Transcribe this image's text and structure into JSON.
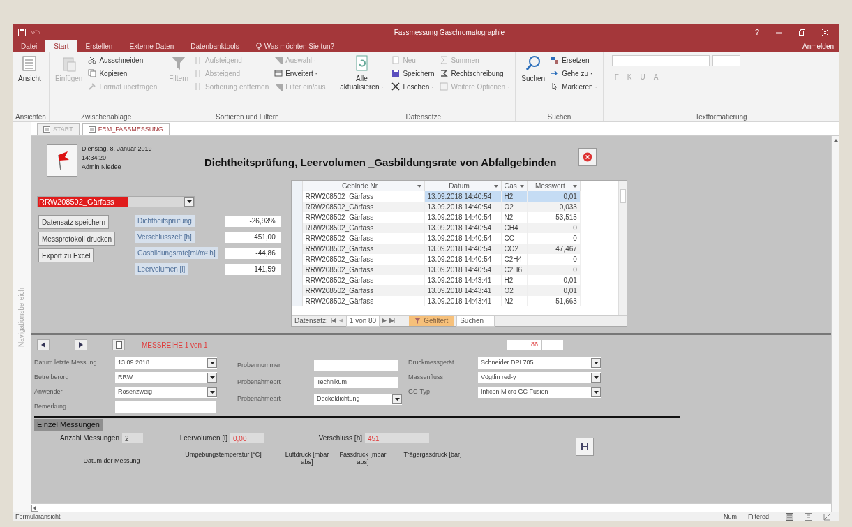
{
  "window": {
    "title": "Fassmessung Gaschromatographie",
    "account": "Anmelden",
    "help": "?"
  },
  "ribbon_tabs": [
    {
      "label": "Datei",
      "selected": false
    },
    {
      "label": "Start",
      "selected": true
    },
    {
      "label": "Erstellen",
      "selected": false
    },
    {
      "label": "Externe Daten",
      "selected": false
    },
    {
      "label": "Datenbanktools",
      "selected": false
    }
  ],
  "tell_me": "Was möchten Sie tun?",
  "ribbon_groups": [
    {
      "label": "Ansichten",
      "items": [
        {
          "label": "Ansicht",
          "kind": "large",
          "disabled": false
        }
      ]
    },
    {
      "label": "Zwischenablage",
      "items": [
        {
          "label": "Einfügen",
          "kind": "large",
          "disabled": true
        },
        {
          "label": "Ausschneiden",
          "kind": "small",
          "disabled": false
        },
        {
          "label": "Kopieren",
          "kind": "small",
          "disabled": false
        },
        {
          "label": "Format übertragen",
          "kind": "small",
          "disabled": true
        }
      ]
    },
    {
      "label": "Sortieren und Filtern",
      "items": [
        {
          "label": "Filtern",
          "kind": "large",
          "disabled": true
        },
        {
          "label": "Aufsteigend",
          "kind": "small",
          "disabled": true
        },
        {
          "label": "Absteigend",
          "kind": "small",
          "disabled": true
        },
        {
          "label": "Sortierung entfernen",
          "kind": "small",
          "disabled": true
        },
        {
          "label": "Auswahl ·",
          "kind": "small",
          "disabled": true
        },
        {
          "label": "Erweitert ·",
          "kind": "small",
          "disabled": false
        },
        {
          "label": "Filter ein/aus",
          "kind": "small",
          "disabled": true
        }
      ]
    },
    {
      "label": "Datensätze",
      "items": [
        {
          "label": "Alle aktualisieren ·",
          "kind": "large",
          "disabled": false
        },
        {
          "label": "Neu",
          "kind": "small",
          "disabled": true
        },
        {
          "label": "Speichern",
          "kind": "small",
          "disabled": false
        },
        {
          "label": "Löschen ·",
          "kind": "small",
          "disabled": false
        },
        {
          "label": "Summen",
          "kind": "small",
          "disabled": true
        },
        {
          "label": "Rechtschreibung",
          "kind": "small",
          "disabled": false
        },
        {
          "label": "Weitere Optionen ·",
          "kind": "small",
          "disabled": true
        }
      ]
    },
    {
      "label": "Suchen",
      "items": [
        {
          "label": "Suchen",
          "kind": "large",
          "disabled": false
        },
        {
          "label": "Ersetzen",
          "kind": "small",
          "disabled": false
        },
        {
          "label": "Gehe zu ·",
          "kind": "small",
          "disabled": false
        },
        {
          "label": "Markieren ·",
          "kind": "small",
          "disabled": false
        }
      ]
    },
    {
      "label": "Textformatierung",
      "items": [
        {
          "label": "F",
          "kind": "format",
          "disabled": true
        },
        {
          "label": "K",
          "kind": "format",
          "disabled": true
        },
        {
          "label": "U",
          "kind": "format",
          "disabled": true
        },
        {
          "label": "A",
          "kind": "format",
          "disabled": true
        }
      ]
    }
  ],
  "doc_tabs": [
    {
      "label": "START",
      "selected": false
    },
    {
      "label": "FRM_FASSMESSUNG",
      "selected": true
    }
  ],
  "nav_pane": {
    "label": "Navigationsbereich"
  },
  "header": {
    "date": "Dienstag, 8. Januar 2019",
    "time": "14:34:20",
    "user": "Admin Niedee",
    "title": "Dichtheitsprüfung, Leervolumen _Gasbildungsrate von Abfallgebinden"
  },
  "container_combo": {
    "value": "RRW208502_Gärfass"
  },
  "buttons": [
    "Datensatz speichern",
    "Messprotokoll drucken",
    "Export zu Excel"
  ],
  "metrics": [
    {
      "label": "Dichtheitsprüfung",
      "value": "-26,93%"
    },
    {
      "label": "Verschlusszeit [h]",
      "value": "451,00"
    },
    {
      "label": "Gasbildungsrate[ml/m² h]",
      "value": "-44,86"
    },
    {
      "label": "Leervolumen [l]",
      "value": "141,59"
    }
  ],
  "datasheet": {
    "columns": [
      "Gebinde Nr",
      "Datum",
      "Gas",
      "Messwert"
    ],
    "rows": [
      {
        "cells": [
          "RRW208502_Gärfass",
          "13.09.2018 14:40:54",
          "H2",
          "0,01"
        ],
        "selected": true
      },
      {
        "cells": [
          "RRW208502_Gärfass",
          "13.09.2018 14:40:54",
          "O2",
          "0,033"
        ],
        "selected": false
      },
      {
        "cells": [
          "RRW208502_Gärfass",
          "13.09.2018 14:40:54",
          "N2",
          "53,515"
        ],
        "selected": false
      },
      {
        "cells": [
          "RRW208502_Gärfass",
          "13.09.2018 14:40:54",
          "CH4",
          "0"
        ],
        "selected": false
      },
      {
        "cells": [
          "RRW208502_Gärfass",
          "13.09.2018 14:40:54",
          "CO",
          "0"
        ],
        "selected": false
      },
      {
        "cells": [
          "RRW208502_Gärfass",
          "13.09.2018 14:40:54",
          "CO2",
          "47,467"
        ],
        "selected": false
      },
      {
        "cells": [
          "RRW208502_Gärfass",
          "13.09.2018 14:40:54",
          "C2H4",
          "0"
        ],
        "selected": false
      },
      {
        "cells": [
          "RRW208502_Gärfass",
          "13.09.2018 14:40:54",
          "C2H6",
          "0"
        ],
        "selected": false
      },
      {
        "cells": [
          "RRW208502_Gärfass",
          "13.09.2018 14:43:41",
          "H2",
          "0,01"
        ],
        "selected": false
      },
      {
        "cells": [
          "RRW208502_Gärfass",
          "13.09.2018 14:43:41",
          "O2",
          "0,01"
        ],
        "selected": false
      },
      {
        "cells": [
          "RRW208502_Gärfass",
          "13.09.2018 14:43:41",
          "N2",
          "51,663"
        ],
        "selected": false
      }
    ],
    "nav_label": "Datensatz:",
    "position": "1 von 80",
    "filter": "Gefiltert",
    "search": "Suchen"
  },
  "series_nav": {
    "label": "MESSREIHE 1 von 1",
    "counter": "86"
  },
  "field_columns": [
    [
      {
        "label": "Datum letzte Messung",
        "value": "13.09.2018",
        "kind": "combo"
      },
      {
        "label": "Betreiberorg",
        "value": "RRW",
        "kind": "combo"
      },
      {
        "label": "Anwender",
        "value": "Rosenzweig",
        "kind": "combo"
      },
      {
        "label": "Bemerkung",
        "kind": "text"
      }
    ],
    [
      {
        "label": "Probennummer",
        "kind": "text"
      },
      {
        "label": "Probenahmeort",
        "value": "Technikum",
        "kind": "text"
      },
      {
        "label": "Probenahmeart",
        "value": "Deckeldichtung",
        "kind": "combo"
      }
    ],
    [
      {
        "label": "Druckmessgerät",
        "value": "Schneider DPI 705",
        "kind": "combo"
      },
      {
        "label": "Massenfluss",
        "value": "Vögtlin red-y",
        "kind": "combo"
      },
      {
        "label": "GC-Typ",
        "value": "Inficon Micro GC Fusion",
        "kind": "combo"
      }
    ]
  ],
  "single_measurements": {
    "title": "Einzel Messungen",
    "summary": [
      {
        "label": "Anzahl Messungen",
        "value": "2",
        "highlight": false
      },
      {
        "label": "Leervolumen [l]",
        "value": "0,00",
        "highlight": true
      },
      {
        "label": "Verschluss [h]",
        "value": "451",
        "highlight": true
      }
    ],
    "columns": [
      "Datum der Messung",
      "Umgebungstemperatur [°C]",
      "Luftdruck [mbar abs]",
      "Fassdruck [mbar abs]",
      "Trägergasdruck [bar]"
    ]
  },
  "status_bar": {
    "view": "Formularansicht",
    "indicators": [
      "Num",
      "Filtered"
    ]
  }
}
